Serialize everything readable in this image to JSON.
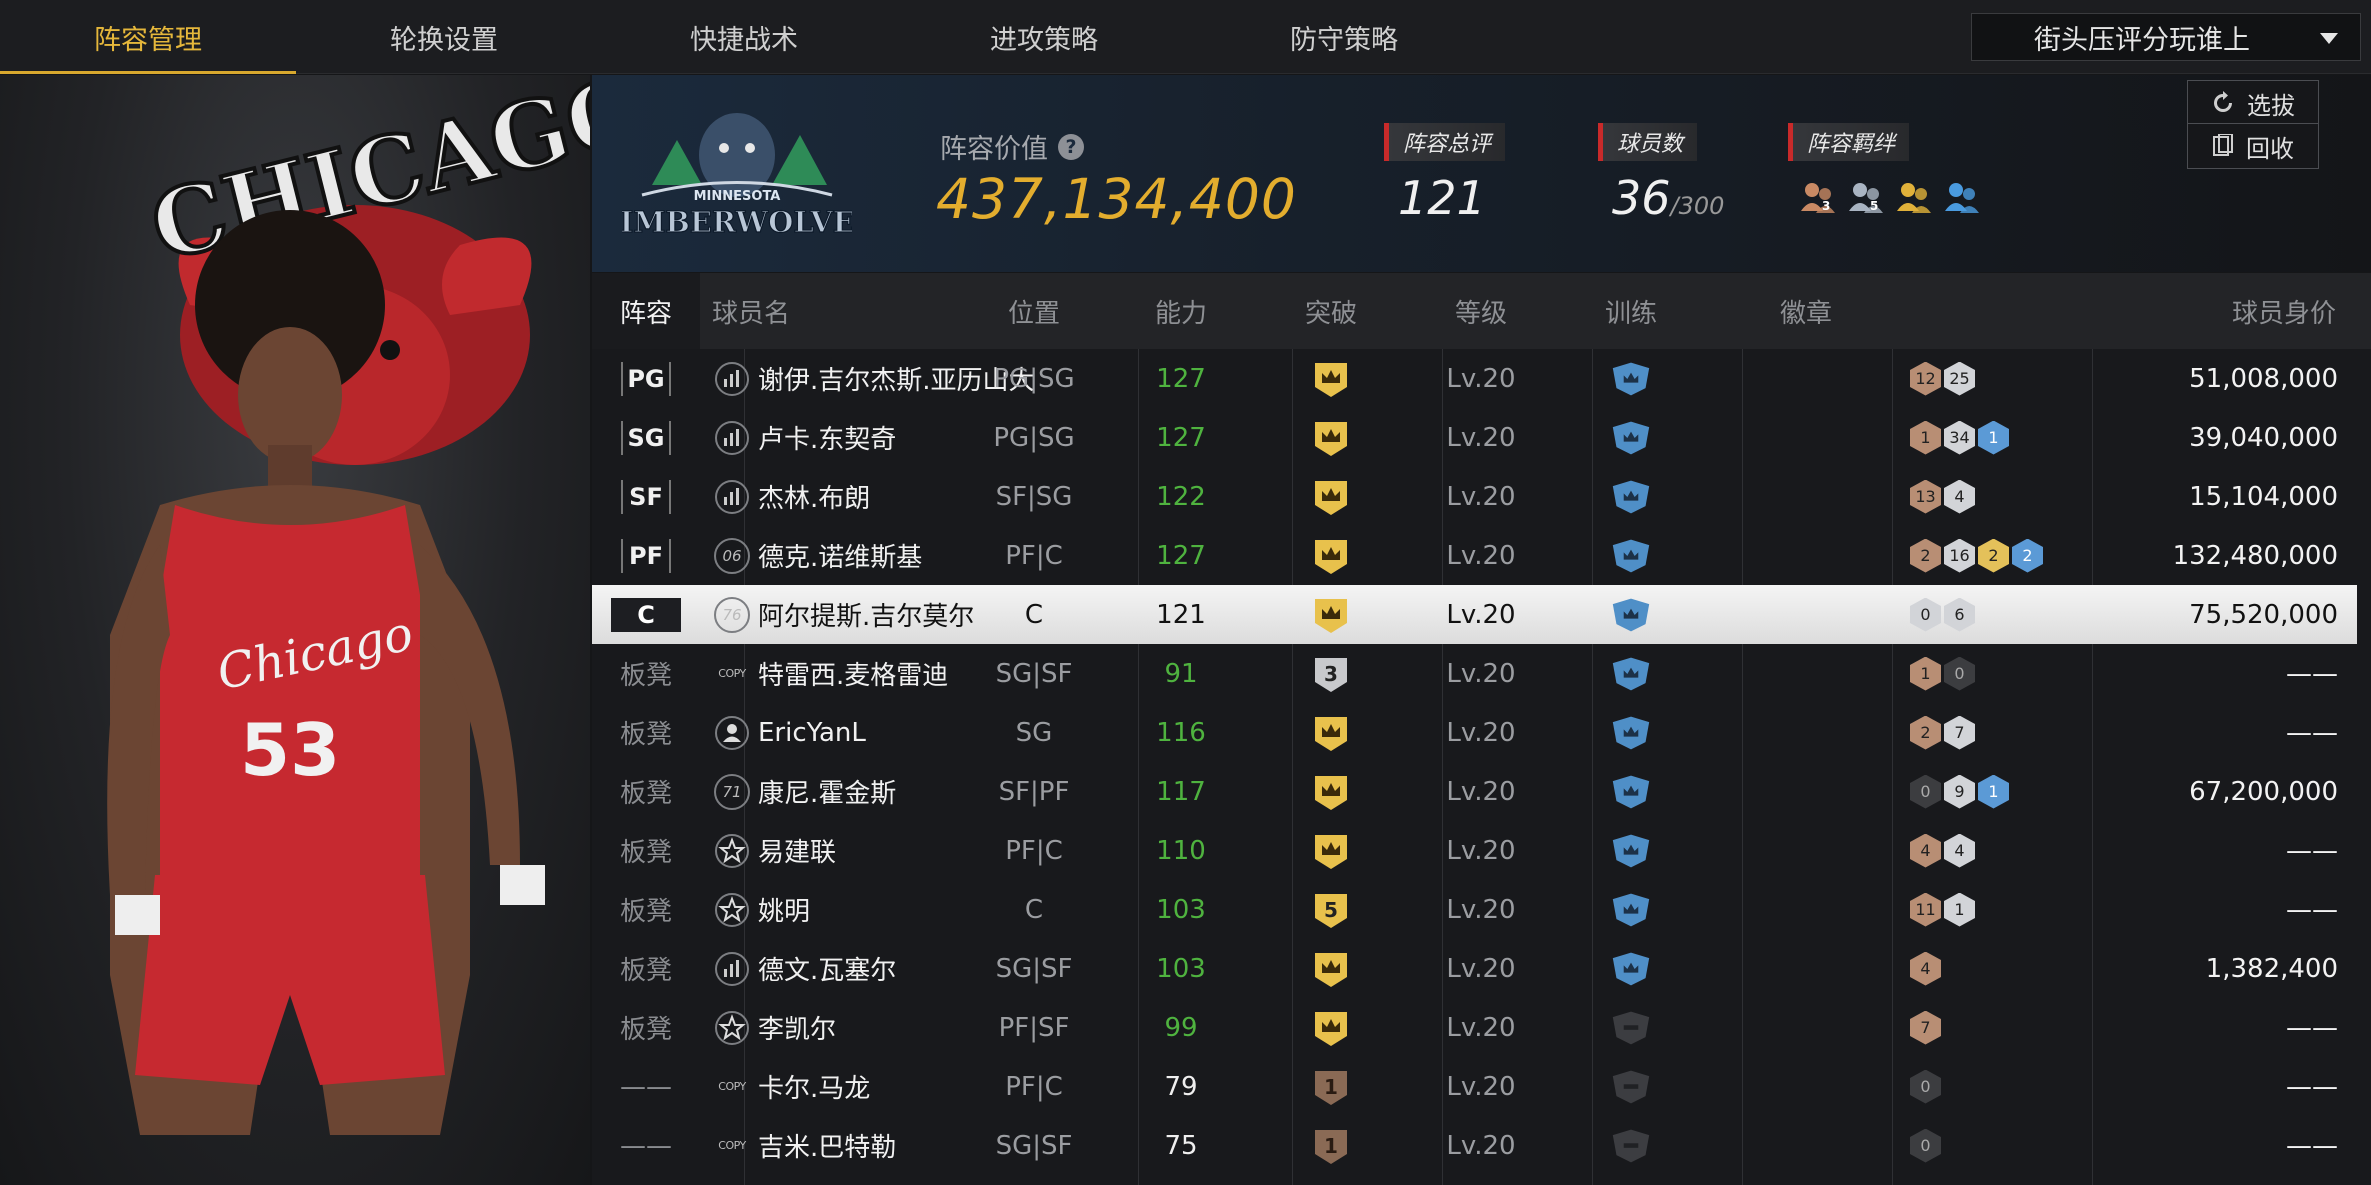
{
  "tabs": [
    {
      "label": "阵容管理",
      "active": true
    },
    {
      "label": "轮换设置",
      "active": false
    },
    {
      "label": "快捷战术",
      "active": false
    },
    {
      "label": "进攻策略",
      "active": false
    },
    {
      "label": "防守策略",
      "active": false
    }
  ],
  "mode_select": {
    "value": "街头压评分玩谁上"
  },
  "hero": {
    "team_text": "CHICAGO BULLS",
    "jersey_text": "Chicago",
    "jersey_number": "53"
  },
  "team": {
    "logo_text_top": "MINNESOTA",
    "logo_text_main": "TIMBERWOLVES",
    "value_label": "阵容价值",
    "value": "437,134,400",
    "overall_label": "阵容总评",
    "overall": "121",
    "players_label": "球员数",
    "players": "36",
    "players_max": "/300",
    "bond_label": "阵容羁绊",
    "bond_icons": [
      {
        "name": "bond-3-icon",
        "num": "3",
        "color": "#c98a64"
      },
      {
        "name": "bond-5-icon",
        "num": "5",
        "color": "#a9b4c2"
      },
      {
        "name": "bond-gold-icon",
        "num": "",
        "color": "#e0b13a"
      },
      {
        "name": "bond-blue-icon",
        "num": "",
        "color": "#4a9be0"
      }
    ],
    "scout_button": "选拔",
    "recycle_button": "回收"
  },
  "table": {
    "headers": [
      "阵容",
      "球员名",
      "位置",
      "能力",
      "突破",
      "等级",
      "训练",
      "徽章",
      "球员身价"
    ],
    "rows": [
      {
        "slot": "PG",
        "starter": true,
        "type": "bars",
        "name": "谢伊.吉尔杰斯.亚历山大",
        "position": "PG|SG",
        "ability": "127",
        "ability_color": "green",
        "break": "crown-gold",
        "level": "Lv.20",
        "training": "blue",
        "badges": [
          [
            "bronze",
            "12"
          ],
          [
            "silver",
            "25"
          ]
        ],
        "value": "51,008,000"
      },
      {
        "slot": "SG",
        "starter": true,
        "type": "bars",
        "name": "卢卡.东契奇",
        "position": "PG|SG",
        "ability": "127",
        "ability_color": "green",
        "break": "crown-gold",
        "level": "Lv.20",
        "training": "blue",
        "badges": [
          [
            "bronze",
            "1"
          ],
          [
            "silver",
            "34"
          ],
          [
            "blue",
            "1"
          ]
        ],
        "value": "39,040,000"
      },
      {
        "slot": "SF",
        "starter": true,
        "type": "bars",
        "name": "杰林.布朗",
        "position": "SF|SG",
        "ability": "122",
        "ability_color": "green",
        "break": "crown-gold",
        "level": "Lv.20",
        "training": "blue",
        "badges": [
          [
            "bronze",
            "13"
          ],
          [
            "silver",
            "4"
          ]
        ],
        "value": "15,104,000"
      },
      {
        "slot": "PF",
        "starter": true,
        "type": "06",
        "name": "德克.诺维斯基",
        "position": "PF|C",
        "ability": "127",
        "ability_color": "green",
        "break": "crown-gold",
        "level": "Lv.20",
        "training": "blue",
        "badges": [
          [
            "bronze",
            "2"
          ],
          [
            "silver",
            "16"
          ],
          [
            "gold",
            "2"
          ],
          [
            "blue",
            "2"
          ]
        ],
        "value": "132,480,000"
      },
      {
        "slot": "C",
        "starter": true,
        "selected": true,
        "type": "76",
        "name": "阿尔提斯.吉尔莫尔",
        "position": "C",
        "ability": "121",
        "ability_color": "white",
        "break": "crown-gold",
        "level": "Lv.20",
        "training": "blue",
        "badges": [
          [
            "silver",
            "0"
          ],
          [
            "silver",
            "6"
          ]
        ],
        "value": "75,520,000"
      },
      {
        "slot": "板凳",
        "starter": false,
        "type": "copy",
        "name": "特雷西.麦格雷迪",
        "position": "SG|SF",
        "ability": "91",
        "ability_color": "green",
        "break": "num-3",
        "level": "Lv.20",
        "training": "blue",
        "badges": [
          [
            "bronze",
            "1"
          ],
          [
            "dark",
            "0"
          ]
        ],
        "value": "——"
      },
      {
        "slot": "板凳",
        "starter": false,
        "type": "person",
        "name": "EricYanL",
        "position": "SG",
        "ability": "116",
        "ability_color": "green",
        "break": "crown-gold",
        "level": "Lv.20",
        "training": "blue",
        "badges": [
          [
            "bronze",
            "2"
          ],
          [
            "silver",
            "7"
          ]
        ],
        "value": "——"
      },
      {
        "slot": "板凳",
        "starter": false,
        "type": "71",
        "name": "康尼.霍金斯",
        "position": "SF|PF",
        "ability": "117",
        "ability_color": "green",
        "break": "crown-gold",
        "level": "Lv.20",
        "training": "blue",
        "badges": [
          [
            "dark",
            "0"
          ],
          [
            "silver",
            "9"
          ],
          [
            "blue",
            "1"
          ]
        ],
        "value": "67,200,000"
      },
      {
        "slot": "板凳",
        "starter": false,
        "type": "star",
        "name": "易建联",
        "position": "PF|C",
        "ability": "110",
        "ability_color": "green",
        "break": "crown-gold",
        "level": "Lv.20",
        "training": "blue",
        "badges": [
          [
            "bronze",
            "4"
          ],
          [
            "silver",
            "4"
          ]
        ],
        "value": "——"
      },
      {
        "slot": "板凳",
        "starter": false,
        "type": "star",
        "name": "姚明",
        "position": "C",
        "ability": "103",
        "ability_color": "green",
        "break": "num-5",
        "level": "Lv.20",
        "training": "blue",
        "badges": [
          [
            "bronze",
            "11"
          ],
          [
            "silver",
            "1"
          ]
        ],
        "value": "——"
      },
      {
        "slot": "板凳",
        "starter": false,
        "type": "bars",
        "name": "德文.瓦塞尔",
        "position": "SG|SF",
        "ability": "103",
        "ability_color": "green",
        "break": "crown-gold",
        "level": "Lv.20",
        "training": "blue",
        "badges": [
          [
            "bronze",
            "4"
          ]
        ],
        "value": "1,382,400"
      },
      {
        "slot": "板凳",
        "starter": false,
        "type": "star",
        "name": "李凯尔",
        "position": "PF|SF",
        "ability": "99",
        "ability_color": "green",
        "break": "crown-gold",
        "level": "Lv.20",
        "training": "gray",
        "badges": [
          [
            "bronze",
            "7"
          ]
        ],
        "value": "——"
      },
      {
        "slot": "——",
        "starter": false,
        "type": "copy",
        "name": "卡尔.马龙",
        "position": "PF|C",
        "ability": "79",
        "ability_color": "white",
        "break": "num-1",
        "level": "Lv.20",
        "training": "gray",
        "badges": [
          [
            "dark",
            "0"
          ]
        ],
        "value": "——"
      },
      {
        "slot": "——",
        "starter": false,
        "type": "copy",
        "name": "吉米.巴特勒",
        "position": "SG|SF",
        "ability": "75",
        "ability_color": "white",
        "break": "num-1",
        "level": "Lv.20",
        "training": "gray",
        "badges": [
          [
            "dark",
            "0"
          ]
        ],
        "value": "——"
      }
    ]
  }
}
